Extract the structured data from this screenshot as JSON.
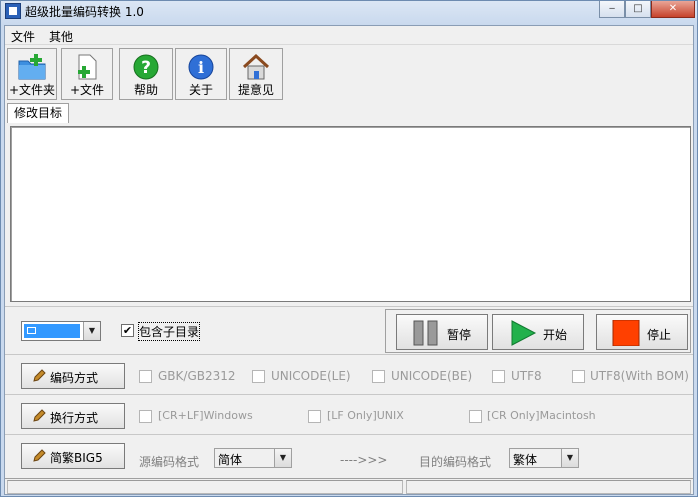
{
  "window": {
    "title": "超级批量编码转换 1.0",
    "controls": {
      "minimize": "‒",
      "maximize": "□",
      "close": "✕"
    }
  },
  "menu": {
    "items": [
      "文件",
      "其他"
    ]
  },
  "toolbar": {
    "buttons": [
      {
        "label": "+文件夹",
        "icon": "add-folder-icon"
      },
      {
        "label": "+文件",
        "icon": "add-file-icon"
      },
      {
        "label": "帮助",
        "icon": "help-icon"
      },
      {
        "label": "关于",
        "icon": "info-icon"
      },
      {
        "label": "提意见",
        "icon": "home-icon"
      }
    ]
  },
  "tabs": [
    {
      "label": "修改目标",
      "selected": true
    }
  ],
  "file_list": {
    "items": []
  },
  "controls": {
    "dir_combo_value": "",
    "include_subdirs": {
      "label": "包含子目录",
      "checked": true,
      "check_glyph": "✔"
    },
    "pause_label": "暂停",
    "start_label": "开始",
    "stop_label": "停止"
  },
  "encoding": {
    "button_label": "编码方式",
    "options": [
      {
        "label": "GBK/GB2312",
        "checked": false
      },
      {
        "label": "UNICODE(LE)",
        "checked": false
      },
      {
        "label": "UNICODE(BE)",
        "checked": false
      },
      {
        "label": "UTF8",
        "checked": false
      },
      {
        "label": "UTF8(With BOM)",
        "checked": false
      }
    ]
  },
  "newline": {
    "button_label": "换行方式",
    "options": [
      {
        "label": "[CR+LF]Windows",
        "checked": false
      },
      {
        "label": "[LF Only]UNIX",
        "checked": false
      },
      {
        "label": "[CR Only]Macintosh",
        "checked": false
      }
    ]
  },
  "big5": {
    "button_label": "简繁BIG5",
    "source_label": "源编码格式",
    "source_value": "简体",
    "arrow": "---->>>",
    "target_label": "目的编码格式",
    "target_value": "繁体"
  },
  "colors": {
    "accent": "#3399ff",
    "start_green": "#22b14c",
    "stop_orange": "#ff4000",
    "disabled_text": "#9a9a9a"
  }
}
